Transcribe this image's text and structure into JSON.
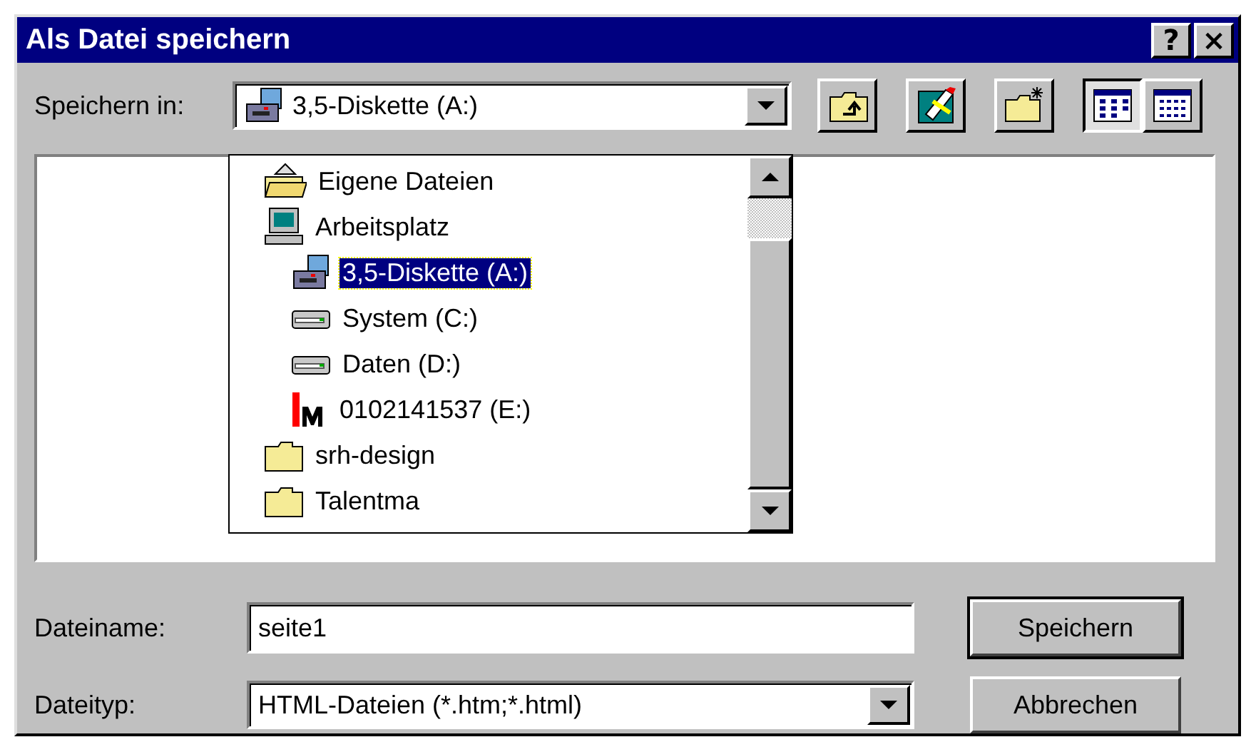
{
  "window": {
    "title": "Als Datei speichern",
    "buttons": [
      {
        "label": "?"
      },
      {
        "label": "×"
      }
    ]
  },
  "save_in": {
    "label": "Speichern in:",
    "value": "3,5-Diskette (A:)",
    "kind": "floppy"
  },
  "toolbar": [
    {
      "kind": "up",
      "selected": false
    },
    {
      "kind": "desktop",
      "selected": false
    },
    {
      "kind": "newfolder",
      "selected": false
    },
    {
      "kind": "list",
      "selected": true
    },
    {
      "kind": "details",
      "selected": false
    }
  ],
  "dropdown": {
    "items": [
      {
        "label": "Eigene Dateien",
        "kind": "docfolder",
        "selected": false
      },
      {
        "label": "Arbeitsplatz",
        "kind": "computer",
        "selected": false,
        "children": [
          {
            "label": "3,5-Diskette (A:)",
            "kind": "floppy",
            "selected": true
          },
          {
            "label": "System (C:)",
            "kind": "drive",
            "selected": false
          },
          {
            "label": "Daten (D:)",
            "kind": "drive",
            "selected": false
          },
          {
            "label": "0102141537 (E:)",
            "kind": "removable",
            "selected": false
          }
        ]
      },
      {
        "label": "srh-design",
        "kind": "folder",
        "selected": false
      },
      {
        "label": "Talentma",
        "kind": "folder",
        "selected": false
      }
    ]
  },
  "filename": {
    "label": "Dateiname:",
    "value": "seite1"
  },
  "filetype": {
    "label": "Dateityp:",
    "value": "HTML-Dateien (*.htm;*.html)"
  },
  "buttons": [
    {
      "label": "Speichern",
      "default": true
    },
    {
      "label": "Abbrechen",
      "default": false
    }
  ]
}
